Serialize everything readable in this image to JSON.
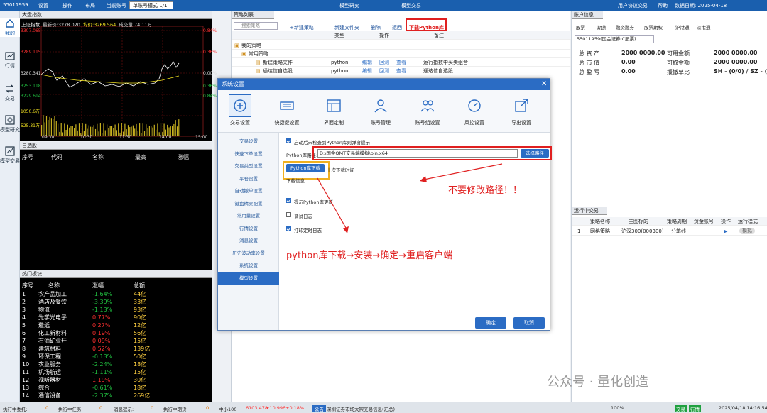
{
  "topbar": {
    "account_id": "55011959",
    "settings": "设置",
    "operate": "操作",
    "layout": "布局",
    "current_account_label": "当前账号",
    "mode_select": "单账号模式 1/1",
    "model_research": "模型研究",
    "model_trade": "模型交易",
    "user_agreement": "用户协议",
    "trade": "交易",
    "help": "帮助",
    "data_date": "数据日期: 2025-04-18"
  },
  "leftnav": [
    {
      "label": "我的",
      "icon": "home-icon"
    },
    {
      "label": "行情",
      "icon": "chart-icon"
    },
    {
      "label": "交易",
      "icon": "trade-icon"
    },
    {
      "label": "模型研究",
      "icon": "research-icon"
    },
    {
      "label": "模型交易",
      "icon": "model-trade-icon"
    }
  ],
  "market": {
    "title": "大盘指数",
    "index_name": "上证指数",
    "latest_label": "最新价:",
    "latest": "3278.020",
    "vol_label": "均价:",
    "avg": "3269.564",
    "volume_label": "成交量",
    "volume": "74.11万",
    "price_ticks": [
      "3307.065",
      "3289.115",
      "3280.341",
      "3253.118",
      "3229.614"
    ],
    "pct_ticks": [
      "0.84%",
      "0.36%",
      "0.00%",
      "0.36%",
      "0.84%"
    ],
    "vol_ticks": [
      "1050.6万",
      "525.31万"
    ],
    "time_ticks": [
      "09:30",
      "10:30",
      "11:30",
      "14:00",
      "15:00"
    ],
    "up_color": "#ff3030",
    "down_color": "#20c040"
  },
  "watchlist": {
    "title": "自选股",
    "headers": [
      "序号",
      "代码",
      "名称",
      "最高",
      "涨幅"
    ]
  },
  "hot": {
    "title": "热门板块",
    "headers": [
      "序号",
      "名称",
      "涨幅",
      "总额"
    ],
    "rows": [
      [
        "1",
        "农产品加工",
        "-1.64%",
        "44亿"
      ],
      [
        "2",
        "酒店及餐饮",
        "-3.39%",
        "33亿"
      ],
      [
        "3",
        "物流",
        "-1.13%",
        "93亿"
      ],
      [
        "4",
        "光学光电子",
        "0.77%",
        "90亿"
      ],
      [
        "5",
        "造纸",
        "0.27%",
        "12亿"
      ],
      [
        "6",
        "化工新材料",
        "0.19%",
        "56亿"
      ],
      [
        "7",
        "石油矿业开",
        "0.09%",
        "15亿"
      ],
      [
        "8",
        "建筑材料",
        "0.52%",
        "139亿"
      ],
      [
        "9",
        "环保工程",
        "-0.13%",
        "50亿"
      ],
      [
        "10",
        "农业服务",
        "-2.24%",
        "18亿"
      ],
      [
        "11",
        "机场航运",
        "-1.11%",
        "15亿"
      ],
      [
        "12",
        "视听器材",
        "1.19%",
        "30亿"
      ],
      [
        "13",
        "综合",
        "-0.61%",
        "18亿"
      ],
      [
        "14",
        "通信设备",
        "-2.37%",
        "269亿"
      ]
    ]
  },
  "strategy": {
    "title": "策略列表",
    "search_placeholder": "搜索策略",
    "toolbar": [
      "+新建策略",
      "新建文件夹",
      "删除",
      "返回",
      "下载Python库"
    ],
    "headers": [
      "类型",
      "操作",
      "备注"
    ],
    "tree": [
      {
        "name": "我的策略",
        "type": "",
        "ops": [],
        "note": ""
      },
      {
        "name": "常用策略",
        "type": "",
        "ops": [],
        "note": ""
      },
      {
        "name": "新建策略文件",
        "type": "python",
        "ops": [
          "编辑",
          "回测",
          "查看"
        ],
        "note": "运行指数中买卖组合"
      },
      {
        "name": "通达信自选股",
        "type": "python",
        "ops": [
          "编辑",
          "回测",
          "查看"
        ],
        "note": "通达信自选股"
      }
    ]
  },
  "account": {
    "title": "账户信息",
    "tabs": [
      "股票",
      "期货",
      "融资融券",
      "股票期权",
      "沪港通",
      "深港通"
    ],
    "account_select": "55011959(国金证券IC股票)",
    "rows": [
      [
        "总 资 产",
        "2000 0000.00",
        "可用金额",
        "2000 0000.00"
      ],
      [
        "总 市 值",
        "0.00",
        "可取金额",
        "2000 0000.00"
      ],
      [
        "总 盈 亏",
        "0.00",
        "报撤单比",
        "SH - (0/0) / SZ - (0/0)"
      ]
    ]
  },
  "running": {
    "title": "运行中交易",
    "headers": [
      "策略名称",
      "主图标的",
      "策略周期",
      "资金账号",
      "操作",
      "运行模式"
    ],
    "row": {
      "no": "1",
      "name": "网格策略",
      "target": "沪深300(000300)",
      "period": "分笔线",
      "account": "",
      "mode": "模拟"
    }
  },
  "dialog": {
    "title": "系统设置",
    "tabs": [
      "交易设置",
      "快捷键设置",
      "界面定制",
      "账号管理",
      "账号组设置",
      "风控设置",
      "导出设置"
    ],
    "side": [
      "交易设置",
      "快速下单设置",
      "交易类型设置",
      "平仓设置",
      "自动撤单设置",
      "键盘精灵配置",
      "常用量设置",
      "行情设置",
      "消息设置",
      "历史波动率设置",
      "系统设置",
      "模型设置"
    ],
    "check_update": "启动后未检查到Python库则弹窗提示",
    "py_path_label": "Python库路径:",
    "py_path": "D:\\国金QMT交易端模拟\\bin.x64",
    "choose_path": "选择路径",
    "download_btn": "Python库下载",
    "last_download": "上次下载时间",
    "download_info": "下载信息",
    "prompt_update": "提示Python库更新",
    "debug_log": "调试日志",
    "print_log": "打印定时日志",
    "ok": "确定",
    "cancel": "取消"
  },
  "annotations": {
    "note1": "不要修改路径！！",
    "note2": "python库下载→安装→确定→重启客户端",
    "color": "#e02020"
  },
  "status": {
    "items": [
      "执行中委托:",
      "0",
      "执行中任务:",
      "0",
      "消息提示:",
      "0",
      "执行中期货:",
      "0",
      "中小100",
      "6103.478",
      "+10.996",
      "+0.18%",
      "公告",
      "深圳证券市场大宗交易信息(汇总)",
      "100%",
      "交易",
      "行情",
      "2025/04/18 14:16:54"
    ]
  },
  "watermark": "公众号 · 量化创造"
}
